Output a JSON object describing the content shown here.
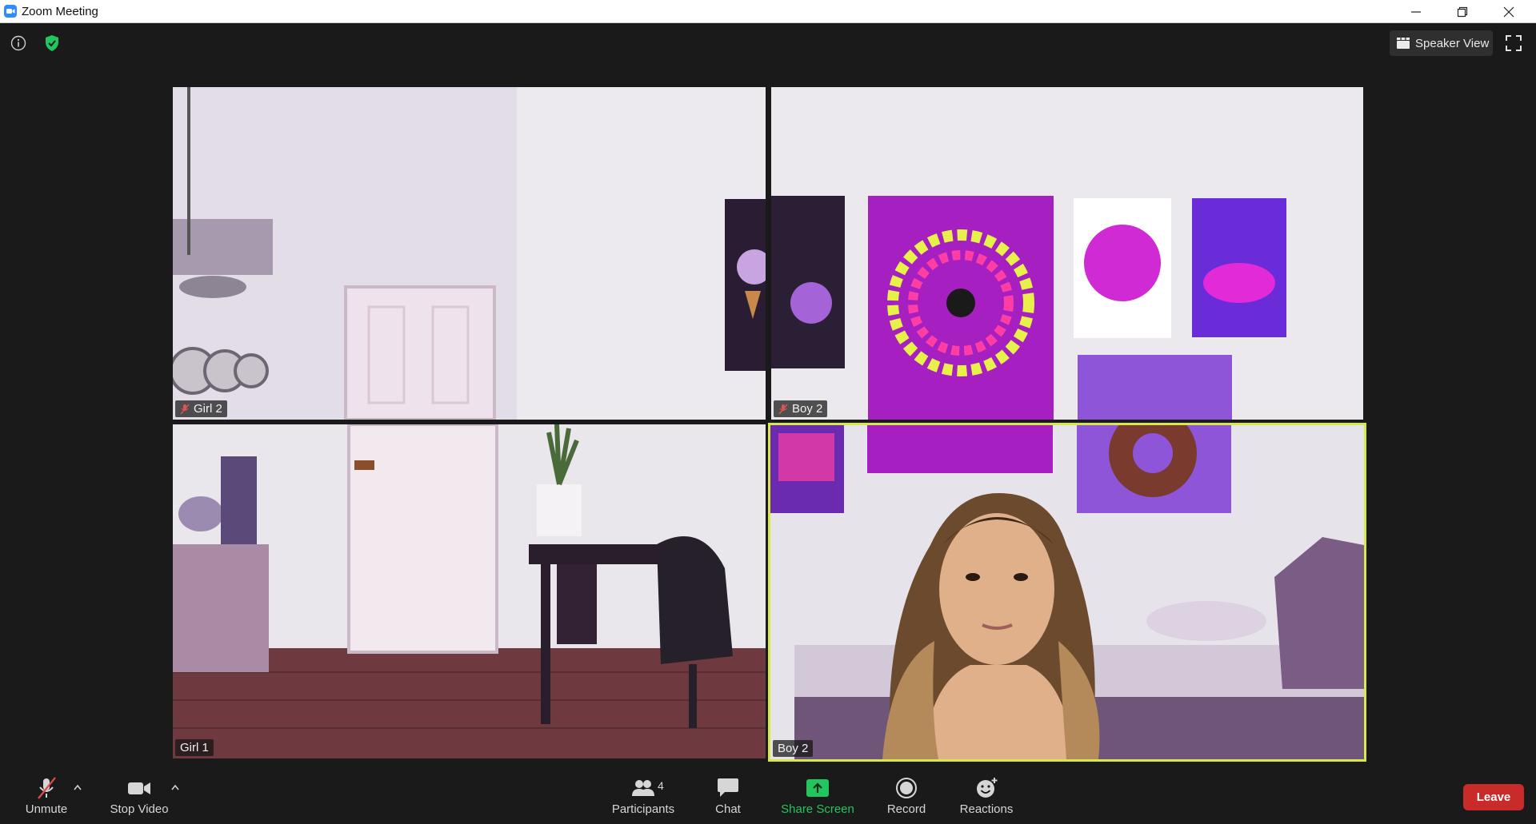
{
  "window": {
    "title": "Zoom Meeting"
  },
  "top_bar": {
    "view_label": "Speaker View"
  },
  "tiles": [
    {
      "name": "Girl 2",
      "muted": true
    },
    {
      "name": "Boy 2",
      "muted": true
    },
    {
      "name": "Girl 1",
      "muted": false
    },
    {
      "name": "Boy 2",
      "muted": false,
      "active_speaker": true
    }
  ],
  "toolbar": {
    "unmute_label": "Unmute",
    "stop_video_label": "Stop Video",
    "participants_label": "Participants",
    "participants_count": "4",
    "chat_label": "Chat",
    "share_screen_label": "Share Screen",
    "record_label": "Record",
    "reactions_label": "Reactions",
    "leave_label": "Leave"
  },
  "colors": {
    "accent_green": "#22c55e",
    "active_border": "#d7e84a",
    "leave_red": "#c92a2a",
    "background": "#1a1a1a"
  },
  "icons": [
    "zoom-app-icon",
    "info-icon",
    "shield-check-icon",
    "speaker-view-icon",
    "fullscreen-icon",
    "mic-muted-icon",
    "video-camera-icon",
    "participants-icon",
    "chat-icon",
    "share-screen-icon",
    "record-icon",
    "reactions-icon",
    "chevron-up-icon"
  ]
}
